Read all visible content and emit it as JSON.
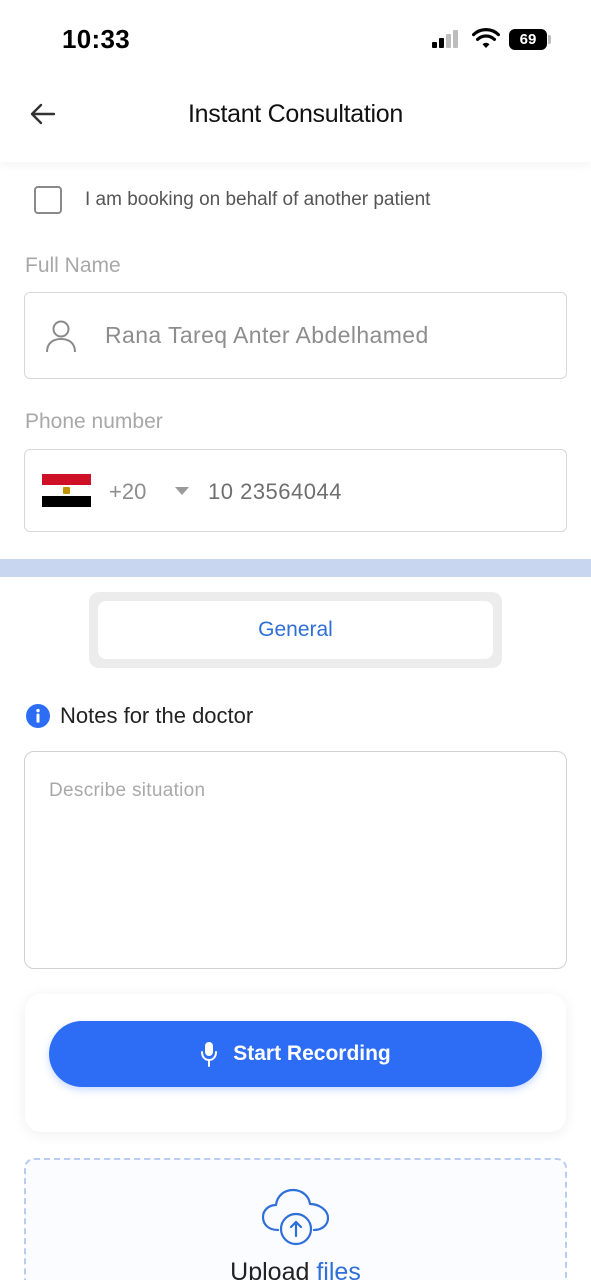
{
  "status_bar": {
    "time": "10:33",
    "battery": "69"
  },
  "header": {
    "title": "Instant Consultation"
  },
  "form": {
    "behalf_label": "I am booking on behalf of another patient",
    "full_name_label": "Full Name",
    "full_name_value": "Rana Tareq Anter Abdelhamed",
    "phone_label": "Phone number",
    "dial_code": "+20",
    "phone_value": "10 23564044"
  },
  "segment": {
    "selected": "General"
  },
  "notes": {
    "label": "Notes for the doctor",
    "placeholder": "Describe situation"
  },
  "recording": {
    "button_label": "Start Recording"
  },
  "upload": {
    "text": "Upload",
    "link": "files"
  },
  "colors": {
    "accent": "#2d6df6",
    "link": "#2f6fd8",
    "band": "#c9d6f0",
    "flag_red": "#ce1126",
    "flag_black": "#000000"
  }
}
